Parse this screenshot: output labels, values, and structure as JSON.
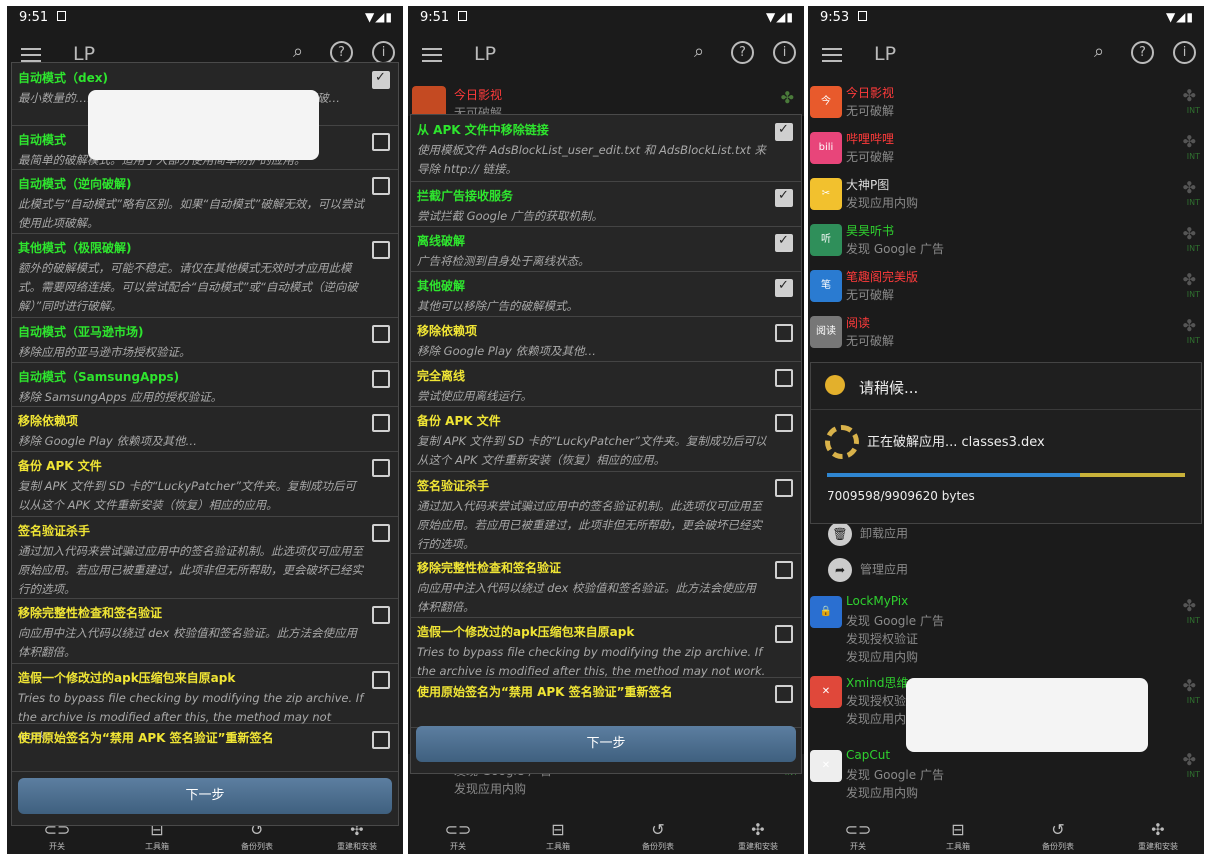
{
  "app_title": "LP",
  "panels": [
    {
      "time": "9:51"
    },
    {
      "time": "9:51"
    },
    {
      "time": "9:53"
    }
  ],
  "bottom_nav": [
    "开关",
    "工具箱",
    "备份列表",
    "重建和安装"
  ],
  "dialog1": {
    "next_label": "下一步",
    "items": [
      {
        "title": "自动模式（dex)",
        "desc": "最小数量的…………………………………效。当您首次打开破…",
        "color": "green",
        "checked": true
      },
      {
        "title": "自动模式",
        "desc": "最简单的破解模式。适用于大部分使用简单防护的应用。",
        "color": "green",
        "checked": false
      },
      {
        "title": "自动模式（逆向破解)",
        "desc": "此模式与“自动模式”略有区别。如果“自动模式”破解无效，可以尝试使用此项破解。",
        "color": "green",
        "checked": false
      },
      {
        "title": "其他模式（极限破解)",
        "desc": "额外的破解模式，可能不稳定。请仅在其他模式无效时才应用此模式。需要网络连接。可以尝试配合“自动模式”或“自动模式（逆向破解）”同时进行破解。",
        "color": "green",
        "checked": false
      },
      {
        "title": "自动模式（亚马逊市场)",
        "desc": "移除应用的亚马逊市场授权验证。",
        "color": "green",
        "checked": false
      },
      {
        "title": "自动模式（SamsungApps)",
        "desc": "移除 SamsungApps 应用的授权验证。",
        "color": "green",
        "checked": false
      },
      {
        "title": "移除依赖项",
        "desc": "移除 Google Play 依赖项及其他…",
        "color": "yellow",
        "checked": false
      },
      {
        "title": "备份 APK 文件",
        "desc": "复制 APK 文件到 SD 卡的“LuckyPatcher”文件夹。复制成功后可以从这个 APK 文件重新安装（恢复）相应的应用。",
        "color": "yellow",
        "checked": false
      },
      {
        "title": "签名验证杀手",
        "desc": "通过加入代码来尝试骗过应用中的签名验证机制。此选项仅可应用至原始应用。若应用已被重建过，此项非但无所帮助，更会破坏已经实行的选项。",
        "color": "yellow",
        "checked": false
      },
      {
        "title": "移除完整性检查和签名验证",
        "desc": "向应用中注入代码以绕过 dex 校验值和签名验证。此方法会使应用体积翻倍。",
        "color": "yellow",
        "checked": false
      },
      {
        "title": "造假一个修改过的apk压缩包来自原apk",
        "desc": "Tries to bypass file checking by modifying the zip archive. If the archive is modified after this, the method may not work.",
        "color": "yellow",
        "checked": false
      },
      {
        "title": "使用原始签名为“禁用 APK 签名验证”重新签名",
        "desc": "",
        "color": "yellow",
        "checked": false
      }
    ]
  },
  "dialog2": {
    "next_label": "下一步",
    "items": [
      {
        "title": "从 APK 文件中移除链接",
        "desc": "使用模板文件 AdsBlockList_user_edit.txt 和 AdsBlockList.txt 来导除 http:// 链接。",
        "color": "green",
        "checked": true
      },
      {
        "title": "拦截广告接收服务",
        "desc": "尝试拦截 Google 广告的获取机制。",
        "color": "green",
        "checked": true
      },
      {
        "title": "离线破解",
        "desc": "广告将检测到自身处于离线状态。",
        "color": "green",
        "checked": true
      },
      {
        "title": "其他破解",
        "desc": "其他可以移除广告的破解模式。",
        "color": "green",
        "checked": true
      },
      {
        "title": "移除依赖项",
        "desc": "移除 Google Play 依赖项及其他…",
        "color": "yellow",
        "checked": false
      },
      {
        "title": "完全离线",
        "desc": "尝试使应用离线运行。",
        "color": "yellow",
        "checked": false
      },
      {
        "title": "备份 APK 文件",
        "desc": "复制 APK 文件到 SD 卡的“LuckyPatcher”文件夹。复制成功后可以从这个 APK 文件重新安装（恢复）相应的应用。",
        "color": "yellow",
        "checked": false
      },
      {
        "title": "签名验证杀手",
        "desc": "通过加入代码来尝试骗过应用中的签名验证机制。此选项仅可应用至原始应用。若应用已被重建过，此项非但无所帮助，更会破坏已经实行的选项。",
        "color": "yellow",
        "checked": false
      },
      {
        "title": "移除完整性检查和签名验证",
        "desc": "向应用中注入代码以绕过 dex 校验值和签名验证。此方法会使应用体积翻倍。",
        "color": "yellow",
        "checked": false
      },
      {
        "title": "造假一个修改过的apk压缩包来自原apk",
        "desc": "Tries to bypass file checking by modifying the zip archive. If the archive is modified after this, the method may not work.",
        "color": "yellow",
        "checked": false
      },
      {
        "title": "使用原始签名为“禁用 APK 签名验证”重新签名",
        "desc": "",
        "color": "yellow",
        "checked": false
      }
    ],
    "background": [
      {
        "name": "今日影视",
        "status": "无可破解"
      },
      {
        "name": "",
        "status": "发现 Google 广告"
      },
      {
        "name": "",
        "status": "发现应用内购"
      }
    ]
  },
  "panel3": {
    "apps": [
      {
        "name": "今日影视",
        "status": "无可破解",
        "name_color": "red",
        "icon_bg": "#e85a2c",
        "icon_text": "今"
      },
      {
        "name": "哔哩哔哩",
        "status": "无可破解",
        "name_color": "red",
        "icon_bg": "#e8457a",
        "icon_text": "bili"
      },
      {
        "name": "大神P图",
        "status": "发现应用内购",
        "name_color": "white",
        "icon_bg": "#f2c12e",
        "icon_text": "✂"
      },
      {
        "name": "昊昊听书",
        "status": "发现 Google 广告",
        "name_color": "green",
        "icon_bg": "#2f8f5a",
        "icon_text": "听"
      },
      {
        "name": "笔趣阁完美版",
        "status": "无可破解",
        "name_color": "red",
        "icon_bg": "#2a7bd1",
        "icon_text": "笔"
      },
      {
        "name": "阅读",
        "status": "无可破解",
        "name_color": "red",
        "icon_bg": "#777777",
        "icon_text": "阅读"
      }
    ],
    "progress": {
      "title": "请稍候...",
      "message": "正在破解应用... classes3.dex",
      "bytes": "7009598/9909620 bytes",
      "fraction": 0.707,
      "secondary_fraction": 1.0
    },
    "actions": [
      "卸载应用",
      "管理应用"
    ],
    "apps_lower": [
      {
        "name": "LockMyPix",
        "lines": [
          "发现 Google 广告",
          "发现授权验证",
          "发现应用内购"
        ],
        "name_color": "green",
        "icon_bg": "#2a6fd1",
        "icon_text": "🔒"
      },
      {
        "name": "Xmind思维",
        "lines": [
          "发现授权验",
          "发现应用内"
        ],
        "name_color": "green",
        "icon_bg": "#e0483a",
        "icon_text": "✕"
      },
      {
        "name": "CapCut",
        "lines": [
          "发现 Google 广告",
          "发现应用内购"
        ],
        "name_color": "green",
        "icon_bg": "#eeeeee",
        "icon_text": "✕"
      }
    ],
    "int_tag": "INT"
  }
}
